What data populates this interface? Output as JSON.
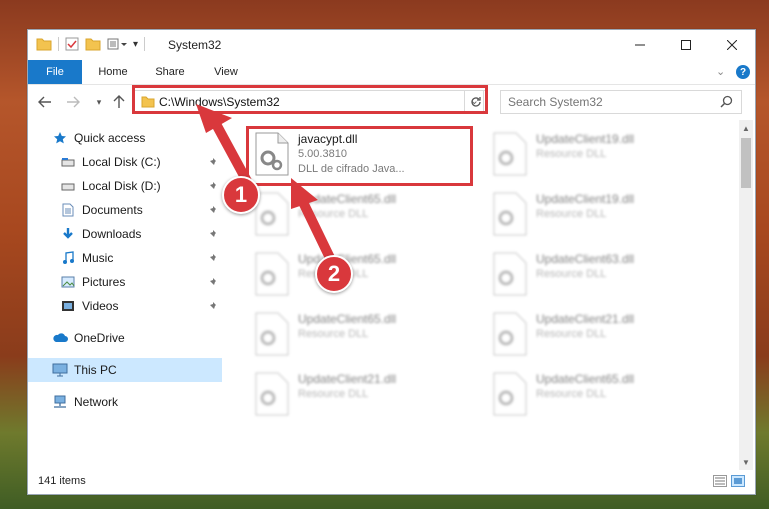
{
  "window": {
    "title": "System32"
  },
  "ribbon": {
    "tabs": [
      "File",
      "Home",
      "Share",
      "View"
    ]
  },
  "address": {
    "path": "C:\\Windows\\System32",
    "search_placeholder": "Search System32"
  },
  "nav": {
    "items": [
      {
        "label": "Quick access",
        "icon": "star-icon",
        "pinned": false
      },
      {
        "label": "Local Disk (C:)",
        "icon": "drive-icon",
        "pinned": true
      },
      {
        "label": "Local Disk (D:)",
        "icon": "drive-icon",
        "pinned": true
      },
      {
        "label": "Documents",
        "icon": "documents-icon",
        "pinned": true
      },
      {
        "label": "Downloads",
        "icon": "download-icon",
        "pinned": true
      },
      {
        "label": "Music",
        "icon": "music-icon",
        "pinned": true
      },
      {
        "label": "Pictures",
        "icon": "pictures-icon",
        "pinned": true
      },
      {
        "label": "Videos",
        "icon": "videos-icon",
        "pinned": true
      },
      {
        "label": "OneDrive",
        "icon": "cloud-icon",
        "pinned": false
      },
      {
        "label": "This PC",
        "icon": "computer-icon",
        "pinned": false,
        "selected": true
      },
      {
        "label": "Network",
        "icon": "network-icon",
        "pinned": false
      }
    ]
  },
  "files": {
    "highlighted": {
      "name": "javacypt.dll",
      "version": "5.00.3810",
      "description": "DLL de cifrado Java..."
    },
    "left_column": [
      {
        "name": "UpdateClient65.dll",
        "type": "Resource DLL"
      },
      {
        "name": "UpdateClient65.dll",
        "type": "Resource DLL"
      },
      {
        "name": "UpdateClient65.dll",
        "type": "Resource DLL"
      },
      {
        "name": "UpdateClient21.dll",
        "type": "Resource DLL"
      }
    ],
    "right_column": [
      {
        "name": "UpdateClient19.dll",
        "type": "Resource DLL"
      },
      {
        "name": "UpdateClient19.dll",
        "type": "Resource DLL"
      },
      {
        "name": "UpdateClient63.dll",
        "type": "Resource DLL"
      },
      {
        "name": "UpdateClient21.dll",
        "type": "Resource DLL"
      },
      {
        "name": "UpdateClient65.dll",
        "type": "Resource DLL"
      }
    ]
  },
  "status": {
    "item_count": "141 items"
  },
  "callouts": {
    "first": "1",
    "second": "2"
  },
  "colors": {
    "accent": "#1979ca",
    "highlight": "#d9383c",
    "selected": "#cce8ff"
  }
}
